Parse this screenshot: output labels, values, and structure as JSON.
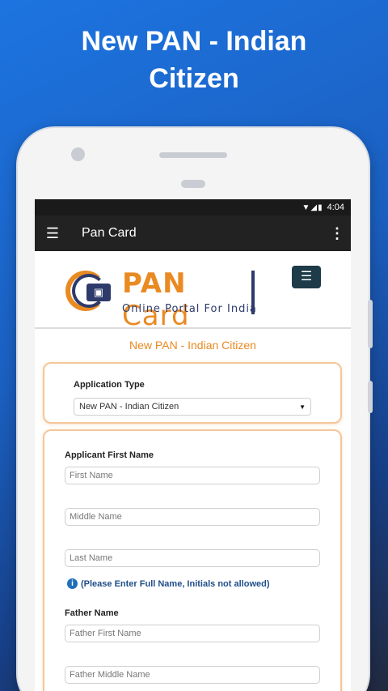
{
  "promo": {
    "title_line1": "New PAN - Indian",
    "title_line2": "Citizen"
  },
  "statusbar": {
    "icons": "▼◢▮",
    "time": "4:04"
  },
  "appbar": {
    "menu_icon": "☰",
    "title": "Pan Card",
    "more_icon": "⋮"
  },
  "header": {
    "logo_word1": "PAN",
    "logo_word2": "Card",
    "logo_subtitle": "Online Portal For India",
    "nav_toggle_icon": "☰"
  },
  "page": {
    "heading": "New PAN - Indian Citizen"
  },
  "application_type": {
    "label": "Application Type",
    "selected": "New PAN - Indian Citizen",
    "caret": "▼"
  },
  "applicant": {
    "label": "Applicant First Name",
    "first_placeholder": "First Name",
    "middle_placeholder": "Middle Name",
    "last_placeholder": "Last Name",
    "info_icon": "i",
    "info_text": "(Please Enter Full Name, Initials not allowed)"
  },
  "father": {
    "label": "Father Name",
    "first_placeholder": "Father First Name",
    "middle_placeholder": "Father Middle Name"
  },
  "colors": {
    "accent_orange": "#e98a22",
    "navy": "#2d3a6b",
    "appbar": "#222222",
    "background_blue": "#1d74e0"
  }
}
